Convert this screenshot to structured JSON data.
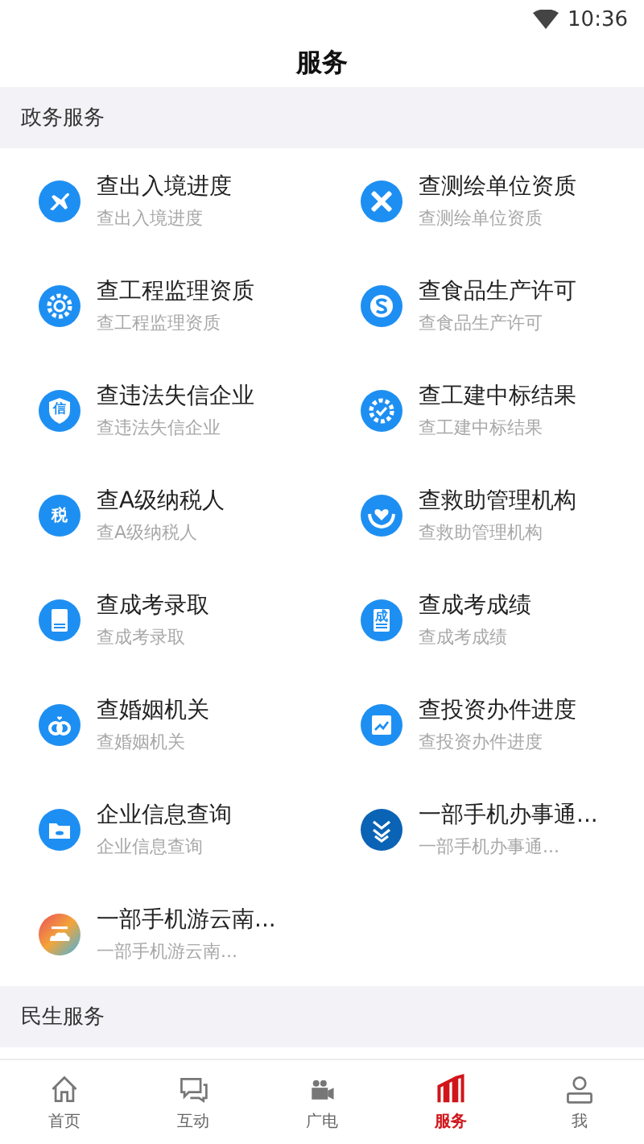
{
  "status_bar": {
    "time": "10:36"
  },
  "header": {
    "title": "服务"
  },
  "sections": [
    {
      "title": "政务服务",
      "items": [
        {
          "title": "查出入境进度",
          "subtitle": "查出入境进度"
        },
        {
          "title": "查测绘单位资质",
          "subtitle": "查测绘单位资质"
        },
        {
          "title": "查工程监理资质",
          "subtitle": "查工程监理资质"
        },
        {
          "title": "查食品生产许可",
          "subtitle": "查食品生产许可"
        },
        {
          "title": "查违法失信企业",
          "subtitle": "查违法失信企业",
          "icon_text": "信"
        },
        {
          "title": "查工建中标结果",
          "subtitle": "查工建中标结果"
        },
        {
          "title": "查A级纳税人",
          "subtitle": "查A级纳税人",
          "icon_text": "税"
        },
        {
          "title": "查救助管理机构",
          "subtitle": "查救助管理机构"
        },
        {
          "title": "查成考录取",
          "subtitle": "查成考录取"
        },
        {
          "title": "查成考成绩",
          "subtitle": "查成考成绩",
          "icon_text": "成"
        },
        {
          "title": "查婚姻机关",
          "subtitle": "查婚姻机关"
        },
        {
          "title": "查投资办件进度",
          "subtitle": "查投资办件进度"
        },
        {
          "title": "企业信息查询",
          "subtitle": "企业信息查询"
        },
        {
          "title": "一部手机办事通...",
          "subtitle": "一部手机办事通..."
        },
        {
          "title": "一部手机游云南...",
          "subtitle": "一部手机游云南..."
        }
      ]
    },
    {
      "title": "民生服务"
    }
  ],
  "tab_bar": [
    {
      "label": "首页",
      "selected": false
    },
    {
      "label": "互动",
      "selected": false
    },
    {
      "label": "广电",
      "selected": false
    },
    {
      "label": "服务",
      "selected": true
    },
    {
      "label": "我",
      "selected": false
    }
  ]
}
